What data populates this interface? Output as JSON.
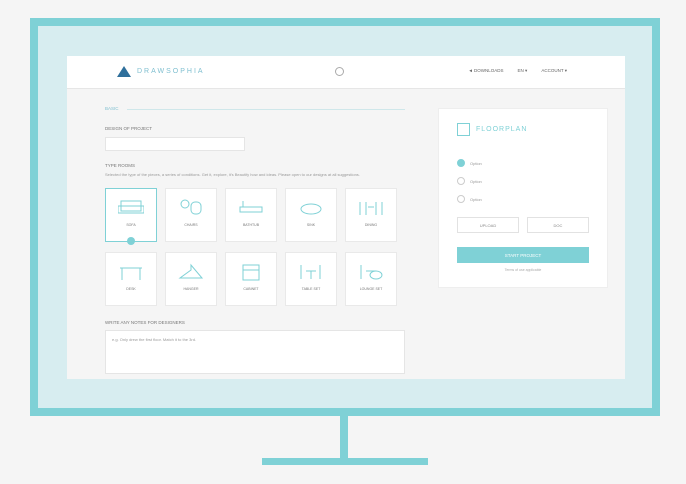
{
  "header": {
    "logo_text": "DRAWSOPHIA",
    "nav": [
      "◄ DOWNLOADS",
      "EN ▾",
      "ACCOUNT ▾"
    ]
  },
  "main": {
    "section_title": "BASIC",
    "project_label": "DESIGN OF PROJECT",
    "type_label": "TYPE ROOMS",
    "type_hint": "Selected the type of the pieces, a series of conditions. Get it, explore, it's Beautify how and ideas. Please open to our designs at all suggestions.",
    "rooms": [
      {
        "label": "SOFA",
        "icon": "sofa-icon"
      },
      {
        "label": "CHAIRS",
        "icon": "chair-icon"
      },
      {
        "label": "BATHTUB",
        "icon": "bathtub-icon"
      },
      {
        "label": "SINK",
        "icon": "sink-icon"
      },
      {
        "label": "DINING",
        "icon": "dining-icon"
      },
      {
        "label": "DESK",
        "icon": "desk-icon"
      },
      {
        "label": "HANGER",
        "icon": "hanger-icon"
      },
      {
        "label": "CABINET",
        "icon": "cabinet-icon"
      },
      {
        "label": "TABLE SET",
        "icon": "table-icon"
      },
      {
        "label": "LOUNGE SET",
        "icon": "lounge-icon"
      }
    ],
    "notes_label": "WRITE ANY NOTES FOR DESIGNERS",
    "notes_placeholder": "e.g. Only drew the first floor. Match it to the 3rd."
  },
  "side": {
    "brand": "FLOORPLAN",
    "options": [
      "Option",
      "Option",
      "Option"
    ],
    "btn_left": "UPLOAD",
    "btn_right": "DOC",
    "start_label": "START PROJECT",
    "fine_print": "Terms of use applicable"
  },
  "colors": {
    "accent": "#7fd1d6",
    "frame": "#7fd1d6"
  }
}
